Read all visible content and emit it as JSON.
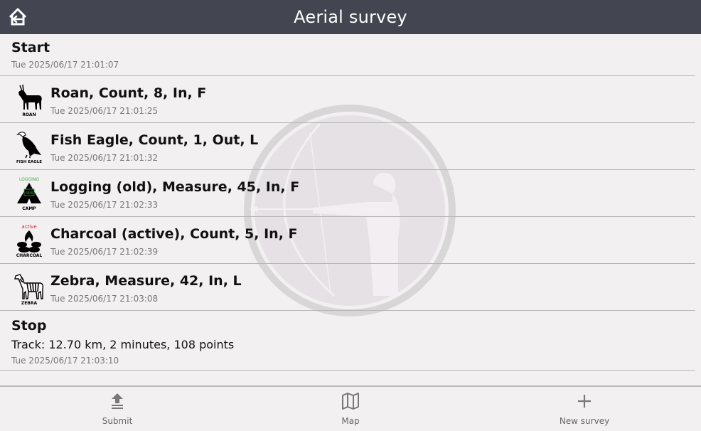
{
  "header": {
    "title": "Aerial survey",
    "home_icon": "home-exit-icon",
    "background": "#434650"
  },
  "start": {
    "title": "Start",
    "time": "Tue 2025/06/17 21:01:07"
  },
  "observations": [
    {
      "title": "Roan, Count, 8, In, F",
      "time": "Tue 2025/06/17 21:01:25",
      "icon": "roan-icon",
      "icon_caption": "ROAN",
      "icon_tag": ""
    },
    {
      "title": "Fish Eagle, Count, 1, Out, L",
      "time": "Tue 2025/06/17 21:01:32",
      "icon": "fish-eagle-icon",
      "icon_caption": "FISH EAGLE",
      "icon_tag": ""
    },
    {
      "title": "Logging (old), Measure, 45, In, F",
      "time": "Tue 2025/06/17 21:02:33",
      "icon": "logging-camp-icon",
      "icon_caption": "CAMP",
      "icon_tag": "LOGGING",
      "icon_subtag": "old"
    },
    {
      "title": "Charcoal (active), Count, 5, In, F",
      "time": "Tue 2025/06/17 21:02:39",
      "icon": "charcoal-icon",
      "icon_caption": "CHARCOAL",
      "icon_tag": "active"
    },
    {
      "title": "Zebra, Measure, 42, In, L",
      "time": "Tue 2025/06/17 21:03:08",
      "icon": "zebra-icon",
      "icon_caption": "ZEBRA",
      "icon_tag": ""
    }
  ],
  "stop": {
    "title": "Stop",
    "track": "Track: 12.70 km, 2 minutes, 108 points",
    "time": "Tue 2025/06/17 21:03:10"
  },
  "bottom_nav": [
    {
      "label": "Submit",
      "icon": "upload-icon"
    },
    {
      "label": "Map",
      "icon": "map-icon"
    },
    {
      "label": "New survey",
      "icon": "plus-icon"
    }
  ],
  "colors": {
    "tag_green": "#3cb043",
    "tag_red": "#d62020"
  }
}
